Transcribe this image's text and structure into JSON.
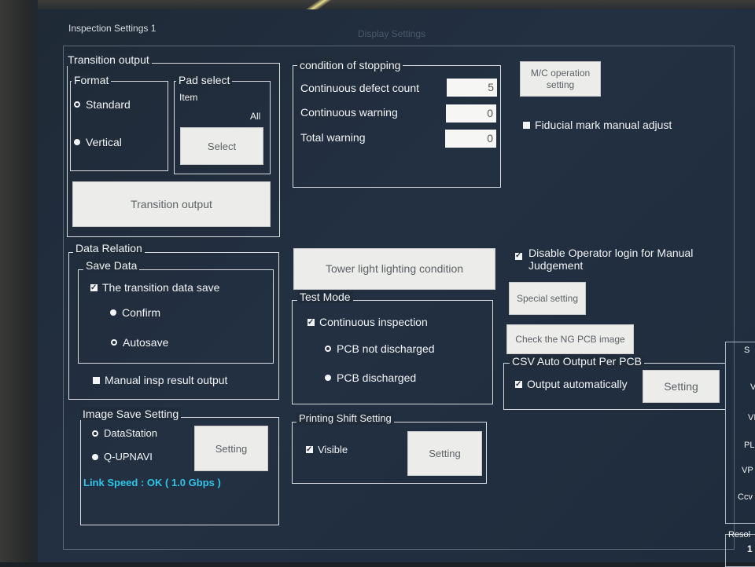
{
  "window": {
    "title": "Inspection Settings 1",
    "faded_tab": "Display Settings"
  },
  "transition": {
    "group_title": "Transition output",
    "format_title": "Format",
    "format_options": [
      "Standard",
      "Vertical"
    ],
    "pad_title": "Pad select",
    "pad_item": "Item",
    "pad_all": "All",
    "select_label": "Select",
    "output_button": "Transition output"
  },
  "stopping": {
    "title": "condition of stopping",
    "rows": [
      {
        "label": "Continuous defect count",
        "value": "5"
      },
      {
        "label": "Continuous warning",
        "value": "0"
      },
      {
        "label": "Total warning",
        "value": "0"
      }
    ]
  },
  "mc_button": "M/C operation\nsetting",
  "fiducial_label": "Fiducial mark manual adjust",
  "data_relation": {
    "title": "Data Relation",
    "save_title": "Save Data",
    "transition_save": "The transition data save",
    "confirm": "Confirm",
    "autosave": "Autosave",
    "manual_output": "Manual insp result output"
  },
  "tower_button": "Tower light lighting condition",
  "test_mode": {
    "title": "Test Mode",
    "continuous": "Continuous inspection",
    "not_discharged": "PCB not discharged",
    "discharged": "PCB discharged"
  },
  "disable_login": "Disable Operator login for Manual Judgement",
  "special_button": "Special setting",
  "check_ng_button": "Check the NG PCB image",
  "csv": {
    "title": "CSV Auto Output Per PCB",
    "auto": "Output automatically",
    "setting": "Setting"
  },
  "image_save": {
    "title": "Image Save Setting",
    "datastation": "DataStation",
    "qupnavi": "Q-UPNAVI",
    "setting": "Setting",
    "link_speed": "Link Speed : OK ( 1.0 Gbps )"
  },
  "printing_shift": {
    "title": "Printing Shift Setting",
    "visible": "Visible",
    "setting": "Setting"
  },
  "right_edge": {
    "s": "S",
    "v1": "V",
    "vi": "VI",
    "pl": "PL",
    "vp": "VP",
    "ccv": "Ccv",
    "resol": "Resol",
    "one": "1"
  },
  "colors": {
    "link": "#2ec4e6",
    "button_bg": "#ececea",
    "panel_bg": "#1f2a36"
  }
}
